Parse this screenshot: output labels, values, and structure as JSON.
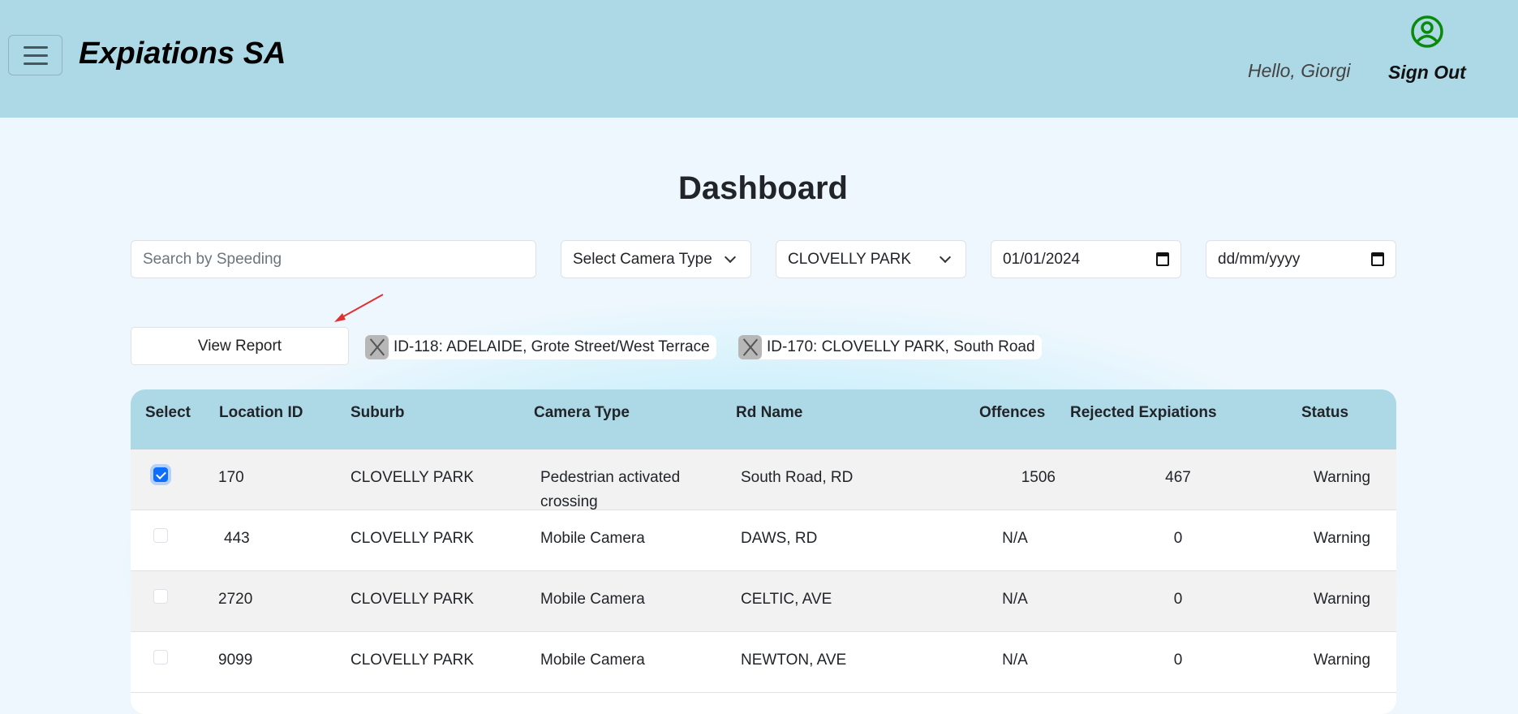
{
  "header": {
    "brand": "Expiations SA",
    "greeting": "Hello, Giorgi",
    "sign_out": "Sign Out"
  },
  "page_title": "Dashboard",
  "filters": {
    "search_placeholder": "Search by Speeding",
    "camera_type": "Select Camera Type",
    "suburb": "CLOVELLY PARK",
    "date_from": "01/01/2024",
    "date_to": "dd/mm/yyyy"
  },
  "view_report": "View Report",
  "chips": [
    "ID-118: ADELAIDE, Grote Street/West Terrace",
    "ID-170: CLOVELLY PARK, South Road"
  ],
  "table": {
    "headers": [
      "Select",
      "Location ID",
      "Suburb",
      "Camera Type",
      "Rd Name",
      "Offences",
      "Rejected Expiations",
      "Status"
    ],
    "rows": [
      {
        "selected": true,
        "id": "170",
        "suburb": "CLOVELLY PARK",
        "camera": "Pedestrian activated crossing",
        "road": "South Road, RD",
        "offences": "1506",
        "rejected": "467",
        "status": "Warning"
      },
      {
        "selected": false,
        "id": "443",
        "suburb": "CLOVELLY PARK",
        "camera": "Mobile Camera",
        "road": "DAWS, RD",
        "offences": "N/A",
        "rejected": "0",
        "status": "Warning"
      },
      {
        "selected": false,
        "id": "2720",
        "suburb": "CLOVELLY PARK",
        "camera": "Mobile Camera",
        "road": "CELTIC, AVE",
        "offences": "N/A",
        "rejected": "0",
        "status": "Warning"
      },
      {
        "selected": false,
        "id": "9099",
        "suburb": "CLOVELLY PARK",
        "camera": "Mobile Camera",
        "road": "NEWTON, AVE",
        "offences": "N/A",
        "rejected": "0",
        "status": "Warning"
      }
    ]
  }
}
